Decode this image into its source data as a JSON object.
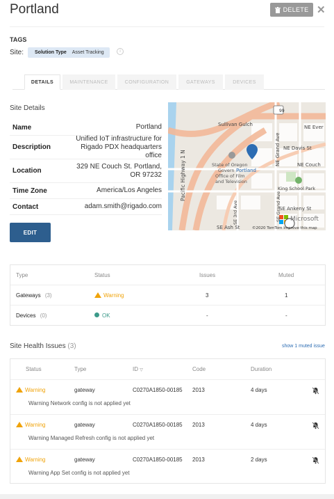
{
  "header": {
    "title": "Portland",
    "delete_label": "DELETE"
  },
  "tags": {
    "heading": "TAGS",
    "site_label": "Site:",
    "tag_key": "Solution Type",
    "tag_value": "Asset Tracking"
  },
  "tabs": [
    "DETAILS",
    "MAINTENANCE",
    "CONFIGURATION",
    "GATEWAYS",
    "DEVICES"
  ],
  "site_details": {
    "title": "Site Details",
    "rows": [
      {
        "key": "Name",
        "value": "Portland"
      },
      {
        "key": "Description",
        "value": "Unified IoT infrastructure for Rigado PDX headquarters office"
      },
      {
        "key": "Location",
        "value": "329 NE Couch St. Portland, OR 97232"
      },
      {
        "key": "Time Zone",
        "value": "America/Los Angeles"
      },
      {
        "key": "Contact",
        "value": "adam.smith@rigado.com"
      }
    ],
    "edit_label": "EDIT"
  },
  "map": {
    "labels": {
      "sullivan": "Sullivan Gulch",
      "ne_everett": "NE Ever",
      "ne_davis": "NE Davis St",
      "ne_grand": "NE Grand Ave",
      "pacific_hwy": "Pacific Highway 1 N",
      "state_oregon": "State of Oregon",
      "govern": "Govern",
      "office_film": "Office of Film",
      "and_tv": "and Television",
      "pin_label": "Portland",
      "ne_couch": "NE Couch",
      "se_3rd": "SE 3rd Ave",
      "king_school": "King School Park",
      "se_ankeny": "SE Ankeny St",
      "se_ash": "SE Ash St",
      "se_grand": "SE Grand Ave",
      "route_99": "99",
      "copyright": "©2020 TomTom  Improve this map",
      "brand": "Microsoft"
    }
  },
  "status_table": {
    "headers": [
      "Type",
      "Status",
      "Issues",
      "Muted"
    ],
    "rows": [
      {
        "type": "Gateways",
        "count": "(3)",
        "status": "Warning",
        "issues": "3",
        "muted": "1"
      },
      {
        "type": "Devices",
        "count": "(0)",
        "status": "OK",
        "issues": "-",
        "muted": "-"
      }
    ],
    "colors": {
      "warning": "#f0a30a",
      "ok": "#3c9a8a"
    }
  },
  "site_health": {
    "title": "Site Health Issues",
    "count": "(3)",
    "muted_link": "show 1 muted issue",
    "headers": [
      "Status",
      "Type",
      "ID",
      "Code",
      "Duration"
    ],
    "issues": [
      {
        "status": "Warning",
        "type": "gateway",
        "id": "C0270A1850-00185",
        "code": "2013",
        "duration": "4 days",
        "message": "Warning Network config is not applied yet"
      },
      {
        "status": "Warning",
        "type": "gateway",
        "id": "C0270A1850-00185",
        "code": "2013",
        "duration": "4 days",
        "message": "Warning Managed Refresh config is not applied yet"
      },
      {
        "status": "Warning",
        "type": "gateway",
        "id": "C0270A1850-00185",
        "code": "2013",
        "duration": "2 days",
        "message": "Warning App Set config is not applied yet"
      }
    ]
  }
}
